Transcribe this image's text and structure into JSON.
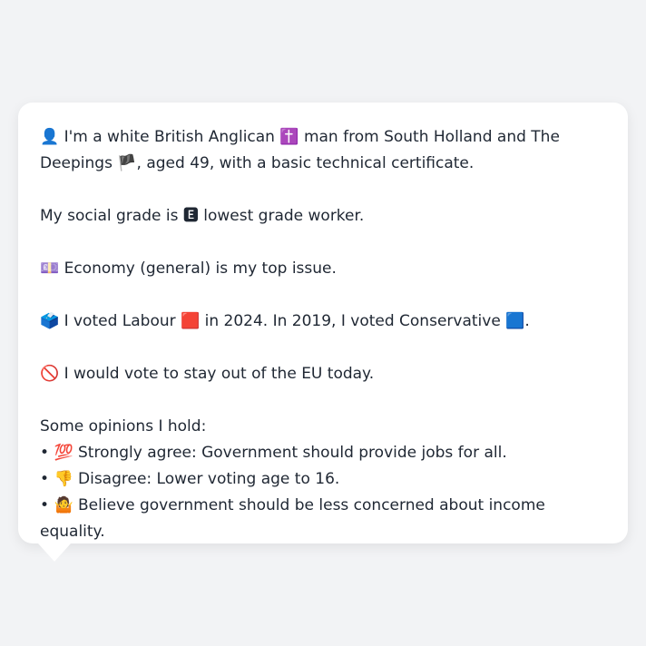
{
  "profile": {
    "line1_icon": "👤",
    "line1_a": " I'm a white British Anglican ",
    "line1_cross": "✝️",
    "line1_b": " man from South Holland and The Deepings ",
    "line1_flag": "🏴",
    "line1_c": ", aged 49, with a basic technical certificate."
  },
  "grade": {
    "text_a": "My social grade is ",
    "badge": "🅴",
    "text_b": " lowest grade worker."
  },
  "issue": {
    "icon": "💷",
    "text": " Economy (general) is my top issue."
  },
  "vote": {
    "icon": "🗳️",
    "text_a": " I voted Labour ",
    "labour_square": "🟥",
    "text_b": " in 2024. In 2019, I voted Conservative ",
    "con_square": "🟦",
    "text_c": "."
  },
  "eu": {
    "icon": "🚫",
    "text": " I would vote to stay out of the EU today."
  },
  "opinions": {
    "heading": "Some opinions I hold:",
    "items": [
      {
        "bullet": "• ",
        "icon": "💯",
        "text": " Strongly agree: Government should provide jobs for all."
      },
      {
        "bullet": "• ",
        "icon": "👎",
        "text": " Disagree: Lower voting age to 16."
      },
      {
        "bullet": "• ",
        "icon": "🤷",
        "text": " Believe government should be less concerned about income equality."
      }
    ]
  }
}
